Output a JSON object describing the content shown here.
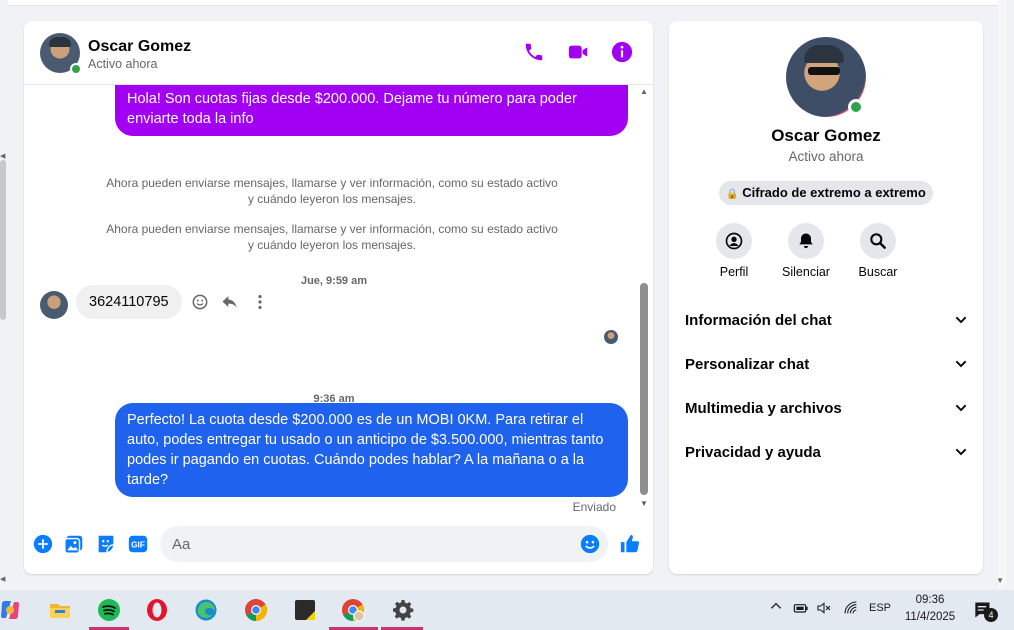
{
  "contact": {
    "name": "Oscar Gomez",
    "status": "Activo ahora"
  },
  "messages": {
    "outgoing_1": "Hola! Son cuotas fijas desde $200.000. Dejame tu número para poder enviarte toda la info",
    "system_1": "Ahora pueden enviarse mensajes, llamarse y ver información, como su estado activo y cuándo leyeron los mensajes.",
    "system_2": "Ahora pueden enviarse mensajes, llamarse y ver información, como su estado activo y cuándo leyeron los mensajes.",
    "timestamp_1": "Jue, 9:59 am",
    "incoming_1": "3624110795",
    "timestamp_2": "9:36 am",
    "outgoing_2": "Perfecto! La cuota desde $200.000 es de un MOBI 0KM. Para retirar el auto, podes entregar tu usado o un anticipo de $3.500.000, mientras tanto podes ir pagando en cuotas. Cuándo podes hablar? A la mañana o a la tarde?",
    "sent_label": "Enviado"
  },
  "composer": {
    "placeholder": "Aa",
    "value": ""
  },
  "info_panel": {
    "name": "Oscar Gomez",
    "status": "Activo ahora",
    "encryption_badge": "Cifrado de extremo a extremo",
    "actions": [
      {
        "label": "Perfil",
        "icon": "profile-icon"
      },
      {
        "label": "Silenciar",
        "icon": "bell-icon"
      },
      {
        "label": "Buscar",
        "icon": "search-icon"
      }
    ],
    "sections": [
      "Información del chat",
      "Personalizar chat",
      "Multimedia y archivos",
      "Privacidad y ayuda"
    ]
  },
  "taskbar": {
    "language": "ESP",
    "time": "09:36",
    "date": "11/4/2025",
    "notification_count": "4"
  },
  "colors": {
    "accent_purple": "#a100f2",
    "accent_blue": "#1f62ee",
    "messenger_blue": "#0a7cff",
    "online_green": "#31a24c"
  }
}
